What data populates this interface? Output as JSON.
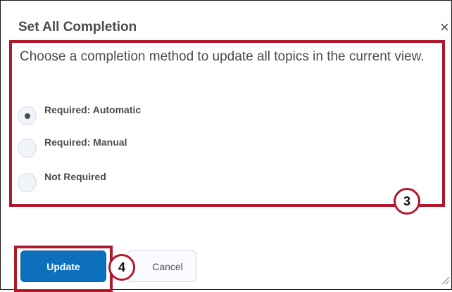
{
  "dialog": {
    "title": "Set All Completion",
    "close_glyph": "×",
    "description": "Choose a completion method to update all topics in the current view."
  },
  "options": [
    {
      "label": "Required: Automatic",
      "selected": true
    },
    {
      "label": "Required: Manual",
      "selected": false
    },
    {
      "label": "Not Required",
      "selected": false
    }
  ],
  "callouts": {
    "options_step": "3",
    "update_step": "4"
  },
  "buttons": {
    "update": "Update",
    "cancel": "Cancel"
  },
  "colors": {
    "primary": "#0d70bd",
    "highlight": "#b0182b"
  },
  "icons": {
    "close": "close-icon",
    "resize": "resize-handle-icon"
  }
}
